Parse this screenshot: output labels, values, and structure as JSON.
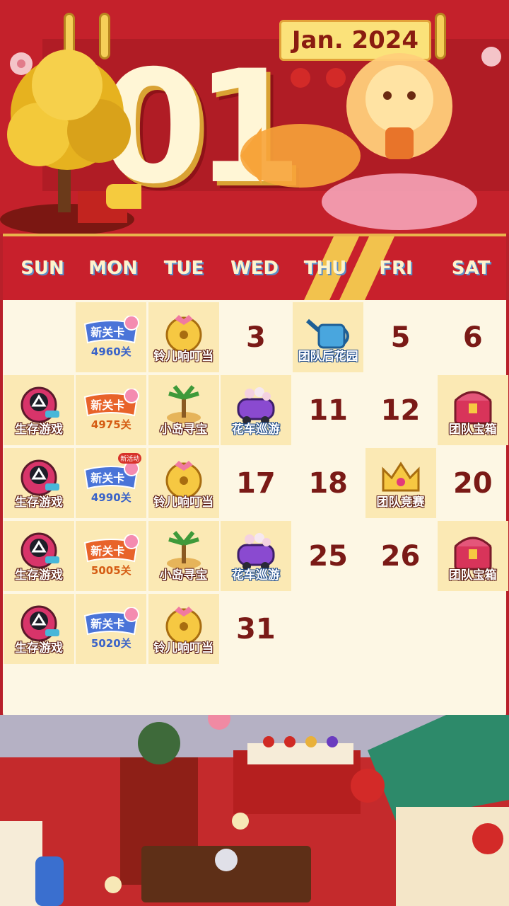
{
  "header": {
    "month_number": "01",
    "month_label": "Jan. 2024"
  },
  "weekdays": [
    "SUN",
    "MON",
    "TUE",
    "WED",
    "THU",
    "FRI",
    "SAT"
  ],
  "calendar": {
    "rows": [
      [
        {
          "type": "empty"
        },
        {
          "type": "level",
          "title": "新关卡",
          "level": "4960关",
          "color": "blue"
        },
        {
          "type": "event",
          "icon": "bell-icon",
          "label": "铃儿响叮当"
        },
        {
          "type": "date",
          "date": "3"
        },
        {
          "type": "event",
          "icon": "watering-can-icon",
          "label": "团队后花园",
          "blue": true
        },
        {
          "type": "date",
          "date": "5"
        },
        {
          "type": "date",
          "date": "6"
        }
      ],
      [
        {
          "type": "event",
          "icon": "squid-game-icon",
          "label": "生存游戏"
        },
        {
          "type": "level",
          "title": "新关卡",
          "level": "4975关",
          "color": "orange"
        },
        {
          "type": "event",
          "icon": "island-treasure-icon",
          "label": "小岛寻宝"
        },
        {
          "type": "event",
          "icon": "flower-car-icon",
          "label": "花车巡游",
          "blue": true
        },
        {
          "type": "date",
          "date": "11"
        },
        {
          "type": "date",
          "date": "12"
        },
        {
          "type": "event",
          "icon": "treasure-chest-icon",
          "label": "团队宝箱"
        }
      ],
      [
        {
          "type": "event",
          "icon": "squid-game-icon",
          "label": "生存游戏"
        },
        {
          "type": "level",
          "title": "新关卡",
          "level": "4990关",
          "color": "blue",
          "tag": "新活动"
        },
        {
          "type": "event",
          "icon": "bell-icon",
          "label": "铃儿响叮当"
        },
        {
          "type": "date",
          "date": "17"
        },
        {
          "type": "date",
          "date": "18"
        },
        {
          "type": "event",
          "icon": "crown-icon",
          "label": "团队竞赛"
        },
        {
          "type": "date",
          "date": "20"
        }
      ],
      [
        {
          "type": "event",
          "icon": "squid-game-icon",
          "label": "生存游戏"
        },
        {
          "type": "level",
          "title": "新关卡",
          "level": "5005关",
          "color": "orange"
        },
        {
          "type": "event",
          "icon": "island-treasure-icon",
          "label": "小岛寻宝"
        },
        {
          "type": "event",
          "icon": "flower-car-icon",
          "label": "花车巡游",
          "blue": true
        },
        {
          "type": "date",
          "date": "25"
        },
        {
          "type": "date",
          "date": "26"
        },
        {
          "type": "event",
          "icon": "treasure-chest-icon",
          "label": "团队宝箱"
        }
      ],
      [
        {
          "type": "event",
          "icon": "squid-game-icon",
          "label": "生存游戏"
        },
        {
          "type": "level",
          "title": "新关卡",
          "level": "5020关",
          "color": "blue"
        },
        {
          "type": "event",
          "icon": "bell-icon",
          "label": "铃儿响叮当"
        },
        {
          "type": "date",
          "date": "31"
        },
        {
          "type": "empty"
        },
        {
          "type": "empty"
        },
        {
          "type": "empty"
        }
      ]
    ]
  },
  "colors": {
    "header_red": "#c4212b",
    "cream": "#fdf7e4",
    "highlight": "#fbe9b4",
    "date_text": "#7a1a16",
    "gold": "#f2c24d"
  }
}
